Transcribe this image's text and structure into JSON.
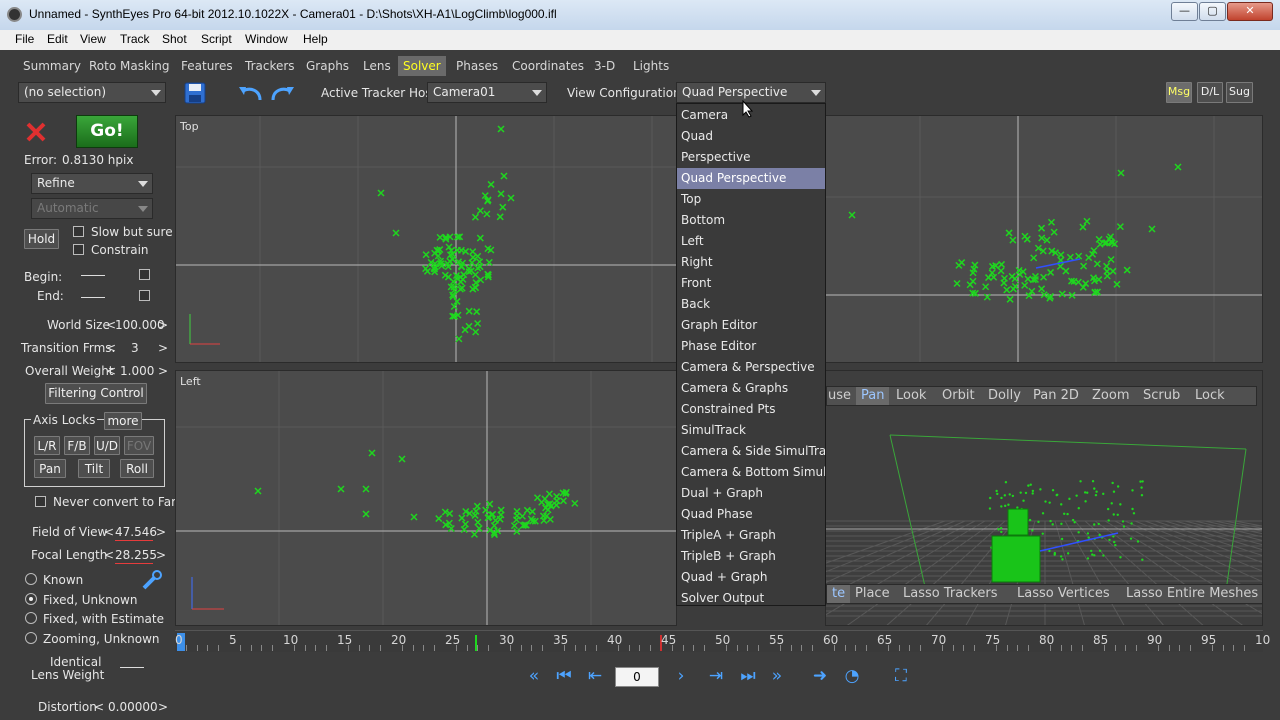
{
  "window": {
    "title": "Unnamed - SynthEyes Pro 64-bit 2012.10.1022X - Camera01 - D:\\Shots\\XH-A1\\LogClimb\\log000.ifl",
    "minimize_glyph": "—",
    "maximize_glyph": "▢",
    "close_glyph": "✕"
  },
  "menu": [
    "File",
    "Edit",
    "View",
    "Track",
    "Shot",
    "Script",
    "Window",
    "Help"
  ],
  "tabs": [
    "Summary",
    "Roto Masking",
    "Features",
    "Trackers",
    "Graphs",
    "Lens",
    "Solver",
    "Phases",
    "Coordinates",
    "3-D",
    "Lights"
  ],
  "active_tab": "Solver",
  "toolbar": {
    "selection": "(no selection)",
    "active_tracker_host_label": "Active Tracker Host:",
    "active_tracker_host": "Camera01",
    "view_config_label": "View Configuration:",
    "view_config": "Quad Perspective",
    "msg": "Msg",
    "dl": "D/L",
    "sug": "Sug"
  },
  "solver": {
    "go": "Go!",
    "error_label": "Error:",
    "error_value": "0.8130 hpix",
    "mode": "Refine",
    "submode": "Automatic",
    "hold": "Hold",
    "slow_but_sure": "Slow but sure",
    "constrain": "Constrain",
    "begin": "Begin:",
    "end": "End:",
    "world_size_label": "World Size",
    "world_size": "100.000",
    "transition_label": "Transition Frms.",
    "transition": "3",
    "overall_weight_label": "Overall Weight",
    "overall_weight": "1.000",
    "filtering_control": "Filtering Control",
    "axis_locks": "Axis Locks",
    "more": "more",
    "lr": "L/R",
    "fb": "F/B",
    "ud": "U/D",
    "fov": "FOV",
    "pan": "Pan",
    "tilt": "Tilt",
    "roll": "Roll",
    "never_convert": "Never convert to Far",
    "fov_label": "Field of View",
    "fov_value": "47.546",
    "focal_label": "Focal Length",
    "focal_value": "28.255",
    "lens_modes": [
      "Known",
      "Fixed, Unknown",
      "Fixed, with Estimate",
      "Zooming, Unknown"
    ],
    "lens_mode_selected": 1,
    "identical_lens_weight_1": "Identical",
    "identical_lens_weight_2": "Lens Weight",
    "distortion_label": "Distortion",
    "distortion": "0.00000",
    "less": "<",
    "more_arrow": ">"
  },
  "viewports": {
    "top_label": "Top",
    "left_label": "Left"
  },
  "view_config_options": [
    "Camera",
    "Quad",
    "Perspective",
    "Quad Perspective",
    "Top",
    "Bottom",
    "Left",
    "Right",
    "Front",
    "Back",
    "Graph Editor",
    "Phase Editor",
    "Camera & Perspective",
    "Camera & Graphs",
    "Constrained Pts",
    "SimulTrack",
    "Camera & Side SimulTrack",
    "Camera & Bottom SimulTrack",
    "Dual + Graph",
    "Quad Phase",
    "TripleA + Graph",
    "TripleB + Graph",
    "Quad + Graph",
    "Solver Output"
  ],
  "view_config_selected_index": 3,
  "mouse_toolbar": [
    "use",
    "Pan",
    "Look",
    "Orbit",
    "Dolly",
    "Pan 2D",
    "Zoom",
    "Scrub",
    "Lock"
  ],
  "mouse_toolbar_active": "Pan",
  "edit_toolbar": [
    "te",
    "Place",
    "Lasso Trackers",
    "Lasso Vertices",
    "Lasso Entire Meshes"
  ],
  "timeline": {
    "ticks": [
      "0",
      "5",
      "10",
      "15",
      "20",
      "25",
      "30",
      "35",
      "40",
      "45",
      "50",
      "55",
      "60",
      "65",
      "70",
      "75",
      "80",
      "85",
      "90",
      "95",
      "10"
    ],
    "current_frame": "0"
  },
  "colors": {
    "tracker": "#1fd61f",
    "accent_tab": "#ffff20",
    "selected_item": "#7b80a6"
  }
}
